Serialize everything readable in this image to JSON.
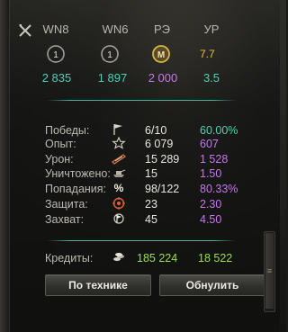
{
  "ratings": [
    {
      "label": "WN8",
      "badge": "1",
      "value": "2 835",
      "badge_style": "circle",
      "color": "#4fd0b4"
    },
    {
      "label": "WN6",
      "badge": "1",
      "value": "1 897",
      "badge_style": "circle",
      "color": "#4fd0b4"
    },
    {
      "label": "РЭ",
      "badge": "M",
      "value": "2 000",
      "badge_style": "gold",
      "color": "#c678f0"
    },
    {
      "label": "УР",
      "badge": "7.7",
      "value": "3.5",
      "badge_style": "text",
      "color": "#4fd0b4"
    }
  ],
  "stats": [
    {
      "label": "Победы:",
      "icon": "flag-icon",
      "value": "6/10",
      "pct": "60.00%",
      "pct_color": "#4fd0b4"
    },
    {
      "label": "Опыт:",
      "icon": "star-icon",
      "value": "6 079",
      "pct": "607",
      "pct_color": "#c678f0"
    },
    {
      "label": "Урон:",
      "icon": "damage-icon",
      "value": "15 289",
      "pct": "1 528",
      "pct_color": "#c678f0"
    },
    {
      "label": "Уничтожено:",
      "icon": "destroyed-icon",
      "value": "15",
      "pct": "1.50",
      "pct_color": "#c678f0"
    },
    {
      "label": "Попадания:",
      "icon": "percent-icon",
      "value": "98/122",
      "pct": "80.33%",
      "pct_color": "#c678f0"
    },
    {
      "label": "Защита:",
      "icon": "defense-icon",
      "value": "23",
      "pct": "2.30",
      "pct_color": "#c678f0"
    },
    {
      "label": "Захват:",
      "icon": "capture-icon",
      "value": "45",
      "pct": "4.50",
      "pct_color": "#c678f0"
    }
  ],
  "credits": {
    "label": "Кредиты:",
    "icon": "credits-icon",
    "value": "185 224",
    "avg": "18 522",
    "color": "#9be04a"
  },
  "buttons": {
    "by_vehicle": "По технике",
    "reset": "Обнулить"
  },
  "colors": {
    "separator": "#3fb59b",
    "teal": "#4fd0b4",
    "purple": "#c678f0",
    "green": "#9be04a",
    "gold": "#d6b44a"
  }
}
